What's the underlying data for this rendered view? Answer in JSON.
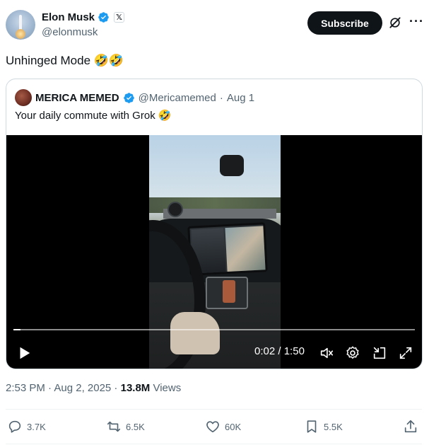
{
  "author": {
    "display_name": "Elon Musk",
    "handle": "@elonmusk",
    "verified_icon": "verified-badge-icon",
    "affiliation_icon": "x-logo-icon",
    "affiliation_glyph": "𝕏"
  },
  "header": {
    "subscribe_label": "Subscribe",
    "grok_icon": "grok-icon",
    "more_glyph": "···"
  },
  "tweet": {
    "text": "Unhinged Mode 🤣🤣"
  },
  "quoted": {
    "display_name": "MERICA MEMED",
    "handle": "@Mericamemed",
    "separator": "·",
    "date": "Aug 1",
    "text": "Your daily commute with Grok 🤣"
  },
  "video": {
    "elapsed": "0:02",
    "duration": "1:50",
    "time_sep": " / ",
    "progress_fraction": 0.018,
    "controls": [
      "play-icon",
      "mute-icon",
      "settings-icon",
      "minimize-icon",
      "fullscreen-icon"
    ]
  },
  "meta": {
    "timestamp": "2:53 PM · Aug 2, 2025 · ",
    "views_count": "13.8M",
    "views_label": " Views"
  },
  "actions": {
    "replies": "3.7K",
    "reposts": "6.5K",
    "likes": "60K",
    "bookmarks": "5.5K"
  },
  "colors": {
    "accent": "#1d9bf0",
    "text_primary": "#0f1419",
    "text_secondary": "#536471",
    "border": "#cfd9de"
  }
}
